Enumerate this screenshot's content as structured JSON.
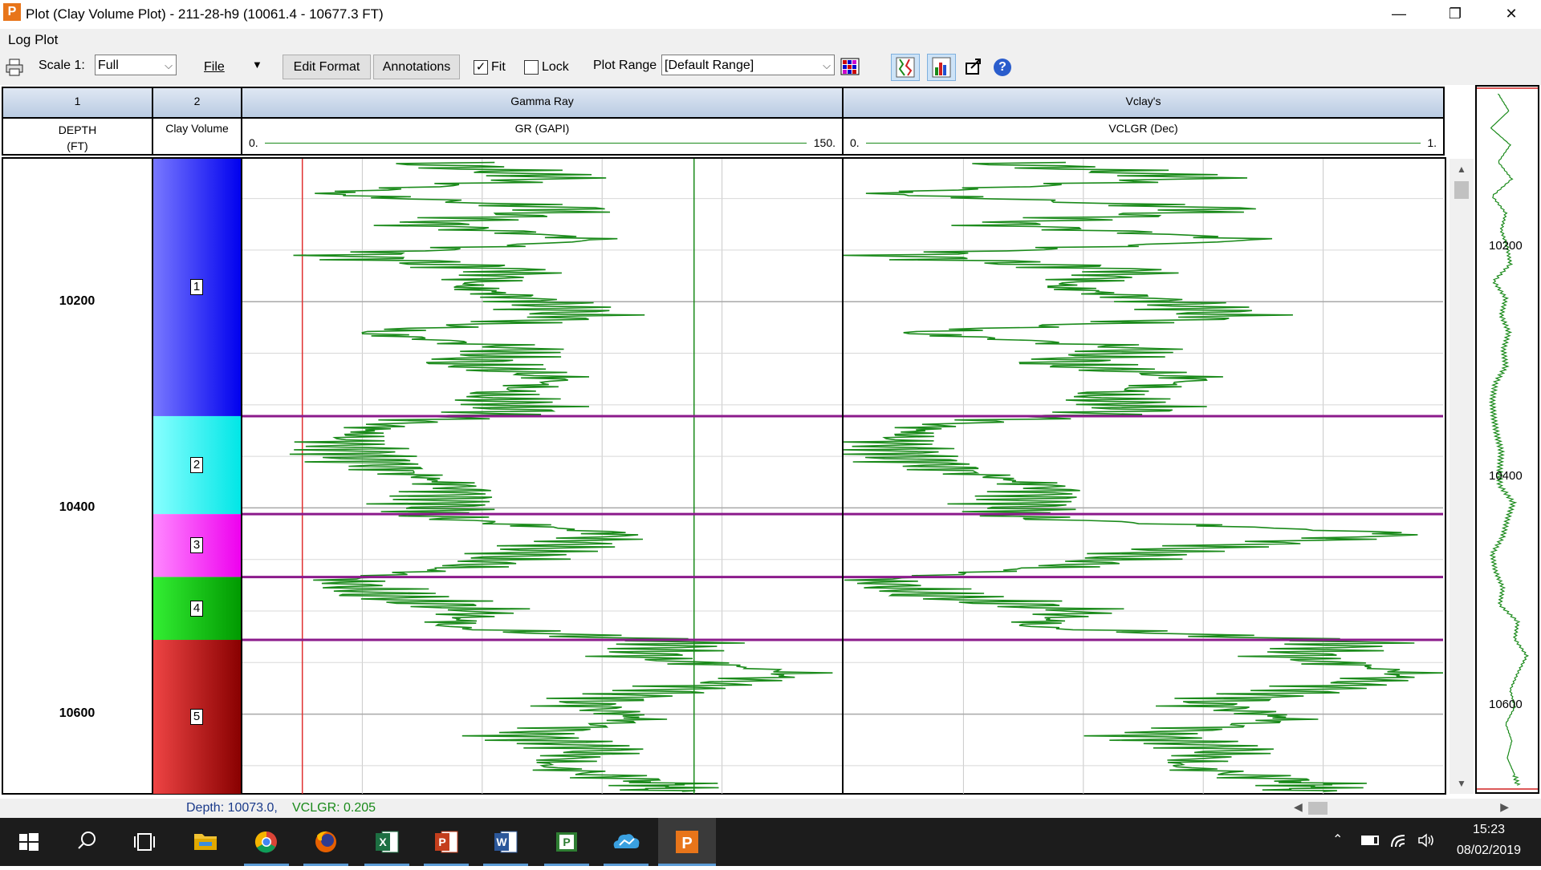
{
  "window": {
    "title": "Plot (Clay Volume Plot) - 211-28-h9 (10061.4 - 10677.3 FT)",
    "minimize": "—",
    "restore": "❐",
    "close": "✕"
  },
  "menu": {
    "log_plot": "Log Plot"
  },
  "toolbar": {
    "scale_label": "Scale 1:",
    "scale_value": "Full",
    "file_label": "File",
    "edit_format": "Edit Format",
    "annotations": "Annotations",
    "fit_label": "Fit",
    "fit_checked": true,
    "lock_label": "Lock",
    "lock_checked": false,
    "plot_range_label": "Plot Range",
    "plot_range_value": "[Default Range]",
    "help": "?"
  },
  "tracks": [
    {
      "number": "1",
      "title": "",
      "curve": "DEPTH\n(FT)"
    },
    {
      "number": "2",
      "title": "",
      "curve": "Clay Volume"
    },
    {
      "number": "",
      "title": "Gamma Ray",
      "curve": "GR (GAPI)",
      "min": "0.",
      "max": "150."
    },
    {
      "number": "",
      "title": "Vclay's",
      "curve": "VCLGR (Dec)",
      "min": "0.",
      "max": "1."
    }
  ],
  "depth_labels": [
    "10200",
    "10400",
    "10600"
  ],
  "overview_labels": [
    "10200",
    "10400",
    "10600"
  ],
  "zones": [
    {
      "label": "1",
      "top": 10061.4,
      "bottom": 10311,
      "color_top": "#7878ff",
      "color_bottom": "#0000ee"
    },
    {
      "label": "2",
      "top": 10311,
      "bottom": 10406,
      "color_top": "#88ffff",
      "color_bottom": "#00e6e6"
    },
    {
      "label": "3",
      "top": 10406,
      "bottom": 10467,
      "color_top": "#ff88ff",
      "color_bottom": "#ee00ee"
    },
    {
      "label": "4",
      "top": 10467,
      "bottom": 10528,
      "color_top": "#33ee33",
      "color_bottom": "#009900"
    },
    {
      "label": "5",
      "top": 10528,
      "bottom": 10677.3,
      "color_top": "#ee4444",
      "color_bottom": "#880000"
    }
  ],
  "colors": {
    "curve": "#1a8a1a",
    "zone_boundary": "#8b1a8b",
    "gr_cutoff_low": "#e03030",
    "gr_cutoff_high": "#1a8a1a"
  },
  "chart_data": {
    "type": "line",
    "title": "",
    "depth_range": [
      10061.4,
      10677.3
    ],
    "series": [
      {
        "name": "GR (GAPI)",
        "xlim": [
          0,
          150
        ],
        "depth": [
          10065,
          10080,
          10095,
          10110,
          10125,
          10140,
          10155,
          10170,
          10185,
          10200,
          10215,
          10230,
          10245,
          10260,
          10275,
          10290,
          10305,
          10320,
          10335,
          10350,
          10365,
          10380,
          10395,
          10410,
          10425,
          10440,
          10455,
          10470,
          10485,
          10500,
          10515,
          10530,
          10545,
          10560,
          10575,
          10590,
          10605,
          10620,
          10635,
          10650,
          10665,
          10675
        ],
        "values": [
          45,
          80,
          20,
          85,
          45,
          90,
          25,
          70,
          55,
          75,
          85,
          30,
          70,
          55,
          80,
          62,
          70,
          35,
          25,
          30,
          40,
          55,
          50,
          50,
          95,
          75,
          60,
          25,
          35,
          60,
          50,
          110,
          100,
          140,
          110,
          85,
          100,
          70,
          90,
          75,
          100,
          110
        ]
      },
      {
        "name": "VCLGR (Dec)",
        "xlim": [
          0,
          1
        ],
        "depth": [
          10065,
          10080,
          10095,
          10110,
          10125,
          10140,
          10155,
          10170,
          10185,
          10200,
          10215,
          10230,
          10245,
          10260,
          10275,
          10290,
          10305,
          10320,
          10335,
          10350,
          10365,
          10380,
          10395,
          10410,
          10425,
          10440,
          10455,
          10470,
          10485,
          10500,
          10515,
          10530,
          10545,
          10560,
          10575,
          10590,
          10605,
          10620,
          10635,
          10650,
          10665,
          10675
        ],
        "values": [
          0.25,
          0.6,
          0.05,
          0.65,
          0.25,
          0.7,
          0.08,
          0.5,
          0.35,
          0.55,
          0.65,
          0.1,
          0.5,
          0.35,
          0.6,
          0.42,
          0.5,
          0.15,
          0.08,
          0.1,
          0.2,
          0.35,
          0.3,
          0.3,
          0.95,
          0.55,
          0.4,
          0.05,
          0.15,
          0.4,
          0.3,
          0.85,
          0.75,
          0.95,
          0.8,
          0.6,
          0.75,
          0.5,
          0.65,
          0.55,
          0.75,
          0.8
        ]
      }
    ],
    "gr_cutoffs": [
      15,
      113
    ]
  },
  "status": {
    "depth_text": "Depth: 10073.0,",
    "vclgr_text": "VCLGR: 0.205"
  },
  "tray": {
    "time": "15:23",
    "date": "08/02/2019"
  }
}
